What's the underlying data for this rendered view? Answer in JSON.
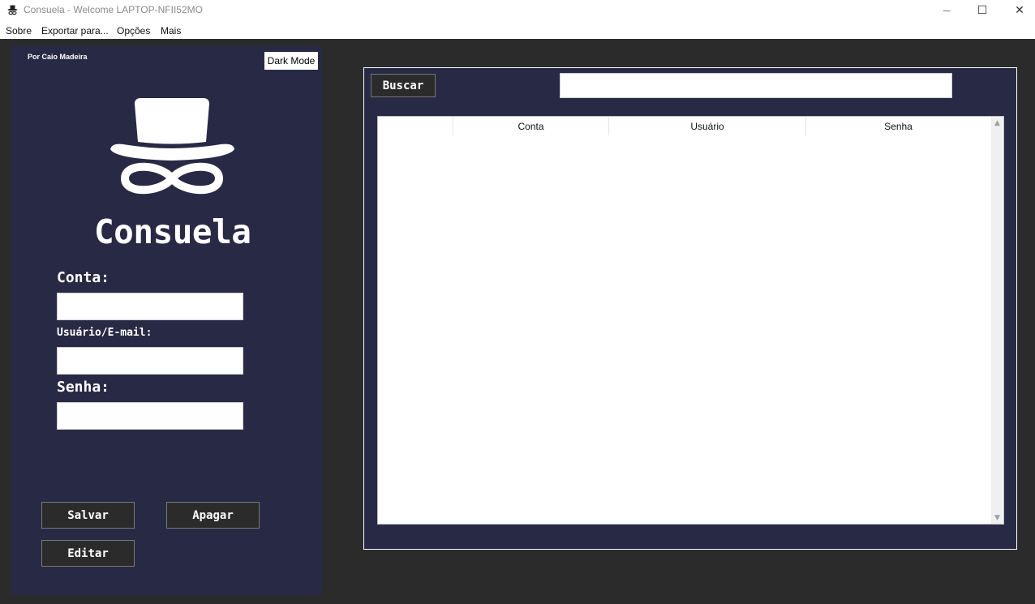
{
  "window": {
    "title": "Consuela - Welcome LAPTOP-NFII52MO",
    "minimize_glyph": "—",
    "maximize_glyph": "☐",
    "close_glyph": "✕"
  },
  "menu": {
    "items": [
      {
        "label": "Sobre"
      },
      {
        "label": "Exportar para..."
      },
      {
        "label": "Opções"
      },
      {
        "label": "Mais"
      }
    ]
  },
  "sidebar": {
    "author": "Por Caio Madeira",
    "dark_mode_label": "Dark Mode",
    "brand": "Consuela",
    "fields": {
      "conta_label": "Conta:",
      "conta_value": "",
      "usuario_label": "Usuário/E-mail:",
      "usuario_value": "",
      "senha_label": "Senha:",
      "senha_value": ""
    },
    "buttons": {
      "save": "Salvar",
      "delete": "Apagar",
      "edit": "Editar"
    }
  },
  "main": {
    "search_button": "Buscar",
    "search_value": "",
    "table": {
      "columns": [
        "",
        "Conta",
        "Usuário",
        "Senha"
      ],
      "rows": []
    },
    "scroll_up_glyph": "▲",
    "scroll_down_glyph": "▼"
  },
  "colors": {
    "panel_bg": "#282a45",
    "window_bg": "#2b2b2b",
    "button_bg": "#2b2b2b",
    "text_light": "#ffffff"
  },
  "icons": {
    "app": "top-hat-mustache-icon",
    "logo": "top-hat-mustache-logo"
  }
}
